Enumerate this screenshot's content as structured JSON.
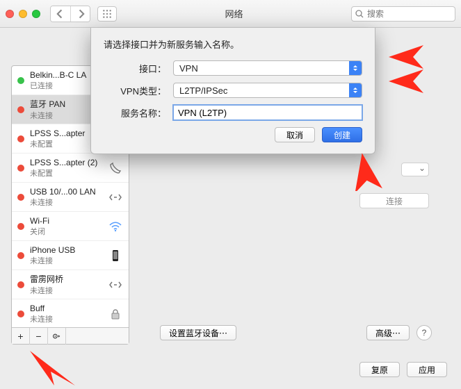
{
  "window": {
    "title": "网络",
    "search_placeholder": "搜索"
  },
  "sheet": {
    "prompt": "请选择接口并为新服务输入名称。",
    "interface_label": "接口：",
    "interface_value": "VPN",
    "vpntype_label": "VPN类型：",
    "vpntype_value": "L2TP/IPSec",
    "service_label": "服务名称：",
    "service_value": "VPN (L2TP)",
    "cancel": "取消",
    "create": "创建"
  },
  "sidebar": {
    "items": [
      {
        "name": "Belkin...B-C LA",
        "status": "已连接",
        "color": "green",
        "icon": "ethernet"
      },
      {
        "name": "蓝牙 PAN",
        "status": "未连接",
        "color": "red",
        "icon": "bluetooth",
        "selected": true
      },
      {
        "name": "LPSS S...apter",
        "status": "未配置",
        "color": "red",
        "icon": "phone"
      },
      {
        "name": "LPSS S...apter (2)",
        "status": "未配置",
        "color": "red",
        "icon": "phone"
      },
      {
        "name": "USB 10/...00 LAN",
        "status": "未连接",
        "color": "red",
        "icon": "ethernet"
      },
      {
        "name": "Wi-Fi",
        "status": "关闭",
        "color": "red",
        "icon": "wifi"
      },
      {
        "name": "iPhone USB",
        "status": "未连接",
        "color": "red",
        "icon": "iphone"
      },
      {
        "name": "雷雳网桥",
        "status": "未连接",
        "color": "red",
        "icon": "thunderbolt"
      },
      {
        "name": "Buff",
        "status": "未连接",
        "color": "red",
        "icon": "lock"
      }
    ]
  },
  "content": {
    "connect": "连接",
    "bt_settings": "设置蓝牙设备⋯",
    "advanced": "高级⋯"
  },
  "bottom": {
    "revert": "复原",
    "apply": "应用"
  }
}
